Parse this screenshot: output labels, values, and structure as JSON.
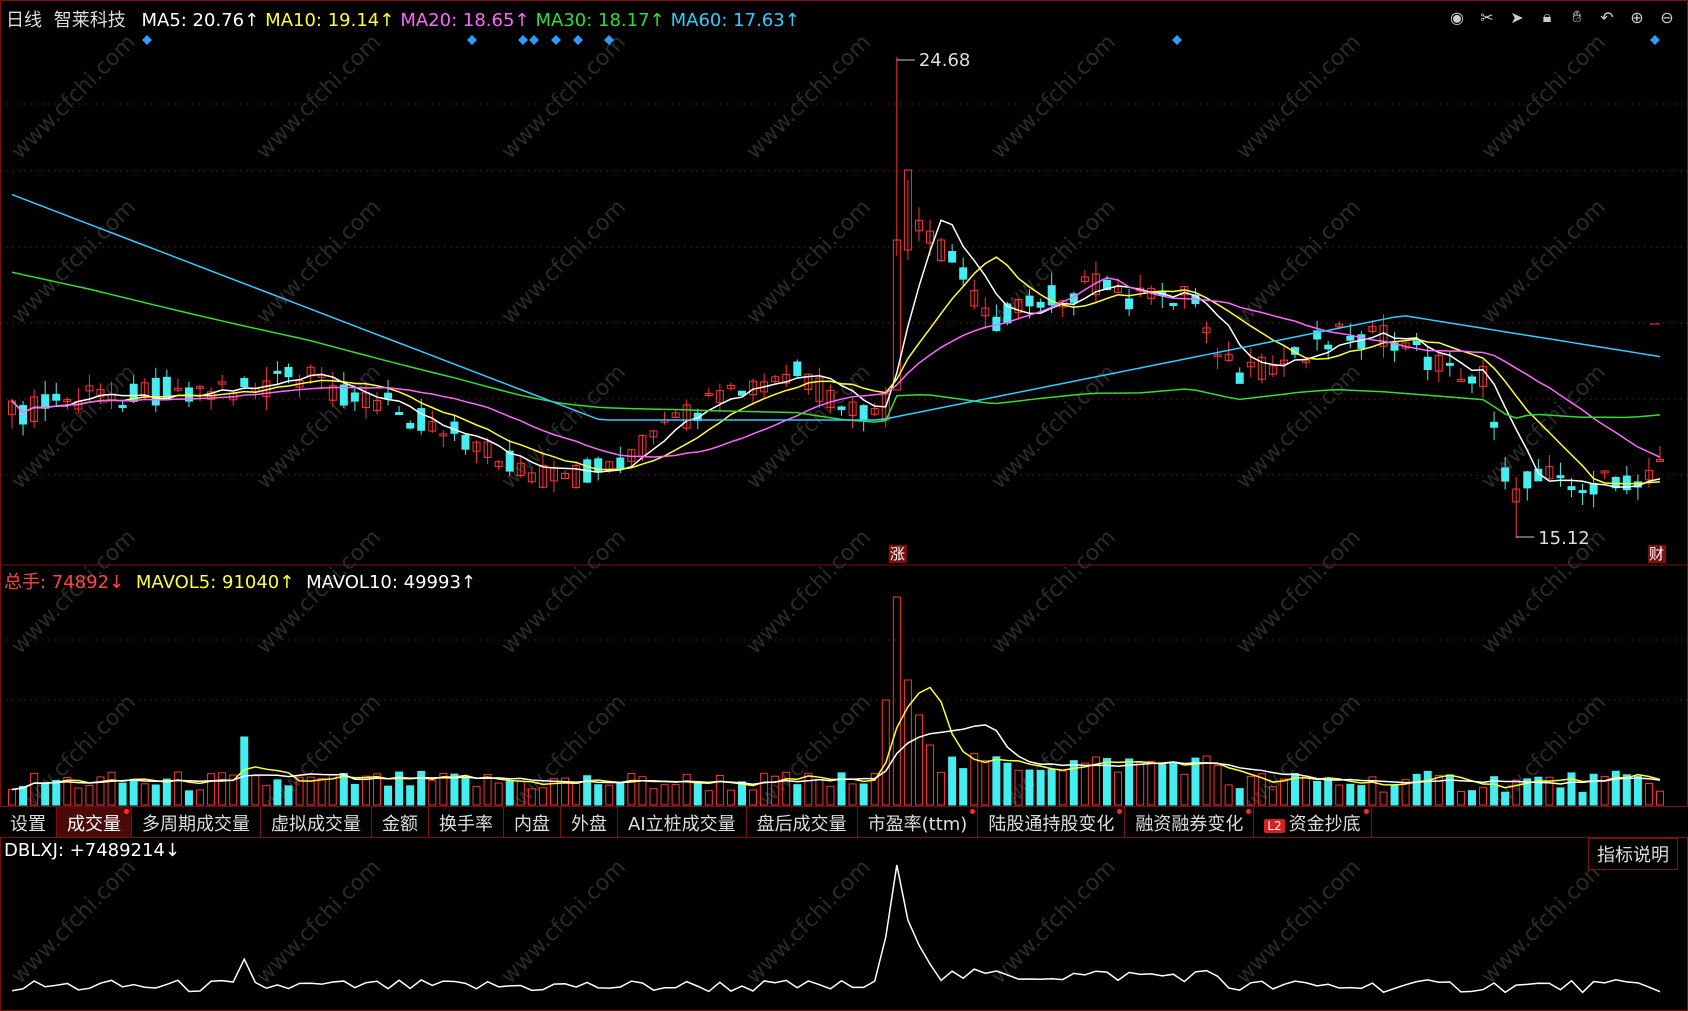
{
  "main_header": {
    "period": "日线",
    "stock_name": "智莱科技",
    "ma": [
      {
        "label": "MA5: 20.76↑",
        "color": "#ffffff"
      },
      {
        "label": "MA10: 19.14↑",
        "color": "#ffff33"
      },
      {
        "label": "MA20: 18.65↑",
        "color": "#ff66ff"
      },
      {
        "label": "MA30: 18.17↑",
        "color": "#33dd33"
      },
      {
        "label": "MA60: 17.63↑",
        "color": "#33ccff"
      }
    ]
  },
  "toolbar_icons": [
    "eye-icon",
    "scissors-icon",
    "play-icon",
    "lock-icon",
    "hand-icon",
    "undo-icon",
    "zoom-in-icon",
    "zoom-out-icon"
  ],
  "annotations": {
    "high_label": "24.68",
    "low_label": "15.12",
    "zhang_tag": "涨",
    "cai_tag": "财"
  },
  "volume_header": {
    "total": {
      "label": "总手: 74892↓",
      "color": "#ff4444"
    },
    "mavol5": {
      "label": "MAVOL5: 91040↑",
      "color": "#ffff33"
    },
    "mavol10": {
      "label": "MAVOL10: 49993↑",
      "color": "#ffffff"
    }
  },
  "tabs": [
    {
      "label": "设置",
      "active": false,
      "dot": false
    },
    {
      "label": "成交量",
      "active": true,
      "dot": true
    },
    {
      "label": "多周期成交量",
      "active": false,
      "dot": false
    },
    {
      "label": "虚拟成交量",
      "active": false,
      "dot": false
    },
    {
      "label": "金额",
      "active": false,
      "dot": false
    },
    {
      "label": "换手率",
      "active": false,
      "dot": false
    },
    {
      "label": "内盘",
      "active": false,
      "dot": false
    },
    {
      "label": "外盘",
      "active": false,
      "dot": false
    },
    {
      "label": "AI立桩成交量",
      "active": false,
      "dot": false
    },
    {
      "label": "盘后成交量",
      "active": false,
      "dot": false
    },
    {
      "label": "市盈率(ttm)",
      "active": false,
      "dot": true
    },
    {
      "label": "陆股通持股变化",
      "active": false,
      "dot": true
    },
    {
      "label": "融资融券变化",
      "active": false,
      "dot": true
    },
    {
      "label": "资金抄底",
      "active": false,
      "dot": true,
      "badge": "L2"
    }
  ],
  "indicator_header": {
    "label": "DBLXJ: +7489214↓"
  },
  "help_button": "指标说明",
  "watermark": "www.cfchi.com",
  "colors": {
    "up": "#ff3333",
    "down": "#44eeee",
    "panel_border": "#7a1010",
    "diamond": "#3399ff"
  }
}
